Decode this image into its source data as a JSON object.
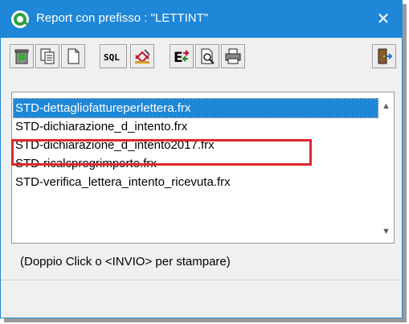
{
  "window": {
    "title": "Report con prefisso : \"LETTINT\"",
    "close_glyph": "✕",
    "accent_color": "#1e87d8"
  },
  "toolbar": {
    "buttons": [
      {
        "icon": "recycle-bin-icon"
      },
      {
        "icon": "copy-icon"
      },
      {
        "icon": "new-document-icon"
      },
      {
        "icon": "sql-icon",
        "label": "SQL"
      },
      {
        "icon": "edit-report-icon"
      },
      {
        "icon": "export-icon"
      },
      {
        "icon": "print-preview-icon"
      },
      {
        "icon": "printer-icon"
      },
      {
        "icon": "exit-icon"
      }
    ]
  },
  "list": {
    "items": [
      "STD-dettagliofattureperlettera.frx",
      "STD-dichiarazione_d_intento.frx",
      "STD-dichiarazione_d_intento2017.frx",
      "STD-ricalcprogrimporto.frx",
      "STD-verifica_lettera_intento_ricevuta.frx"
    ],
    "selected_index": 0,
    "highlighted_index": 2,
    "highlight_color": "#e0262e"
  },
  "hint": "(Doppio Click o <INVIO> per stampare)"
}
